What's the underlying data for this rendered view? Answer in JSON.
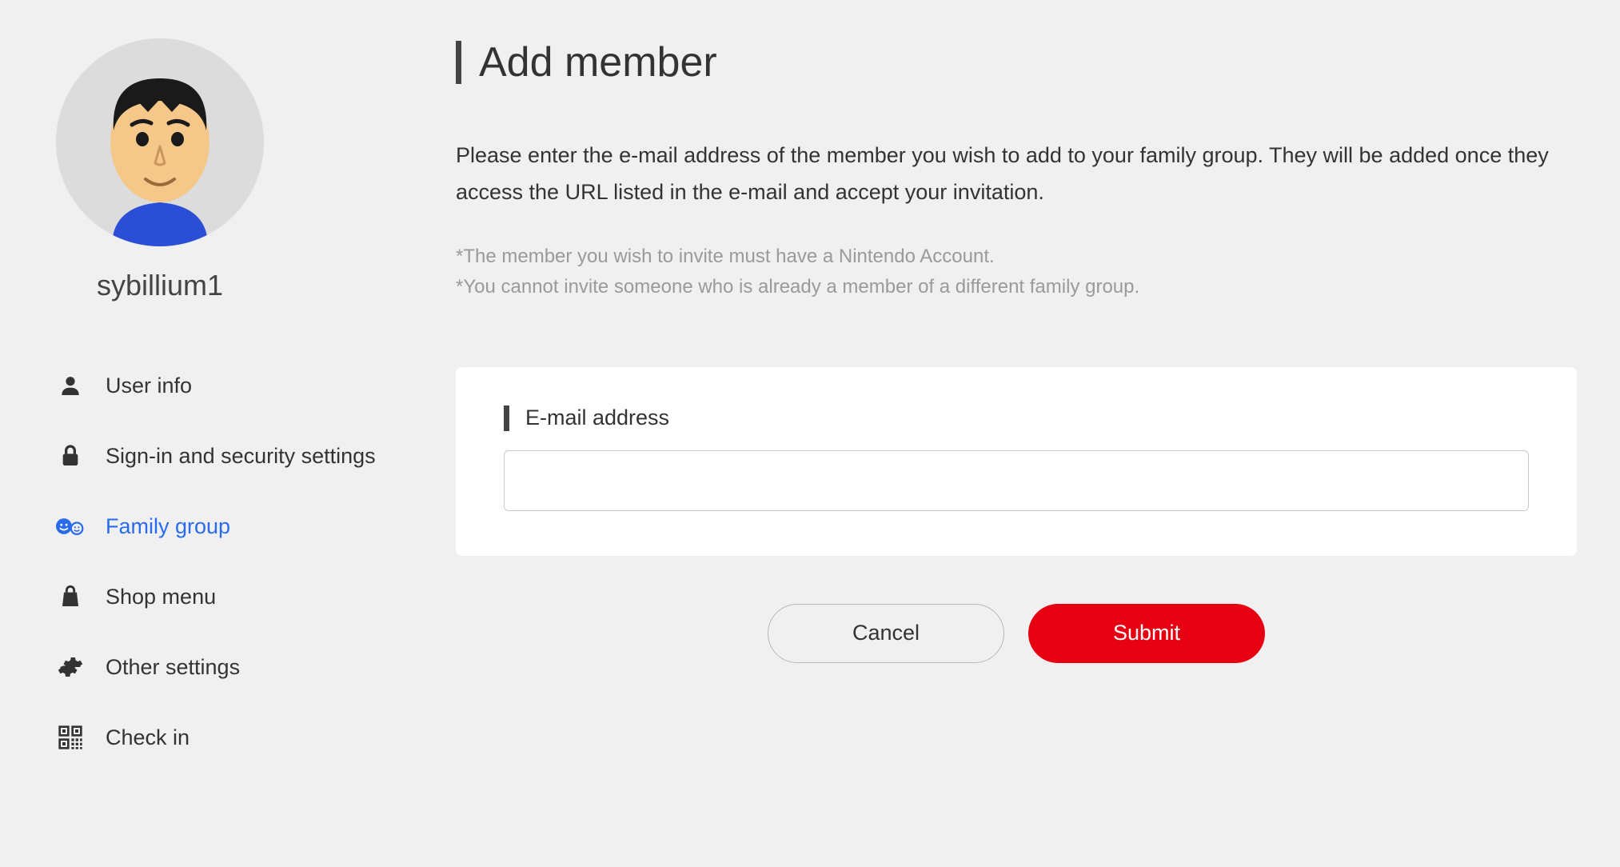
{
  "sidebar": {
    "username": "sybillium1",
    "items": [
      {
        "label": "User info",
        "icon": "user-icon",
        "active": false
      },
      {
        "label": "Sign-in and security settings",
        "icon": "lock-icon",
        "active": false
      },
      {
        "label": "Family group",
        "icon": "family-icon",
        "active": true
      },
      {
        "label": "Shop menu",
        "icon": "shop-icon",
        "active": false
      },
      {
        "label": "Other settings",
        "icon": "gear-icon",
        "active": false
      },
      {
        "label": "Check in",
        "icon": "qr-icon",
        "active": false
      }
    ]
  },
  "main": {
    "title": "Add member",
    "description": "Please enter the e-mail address of the member you wish to add to your family group. They will be added once they access the URL listed in the e-mail and accept your invitation.",
    "note1": "*The member you wish to invite must have a Nintendo Account.",
    "note2": "*You cannot invite someone who is already a member of a different family group.",
    "form": {
      "email_label": "E-mail address",
      "email_value": ""
    },
    "buttons": {
      "cancel": "Cancel",
      "submit": "Submit"
    }
  }
}
